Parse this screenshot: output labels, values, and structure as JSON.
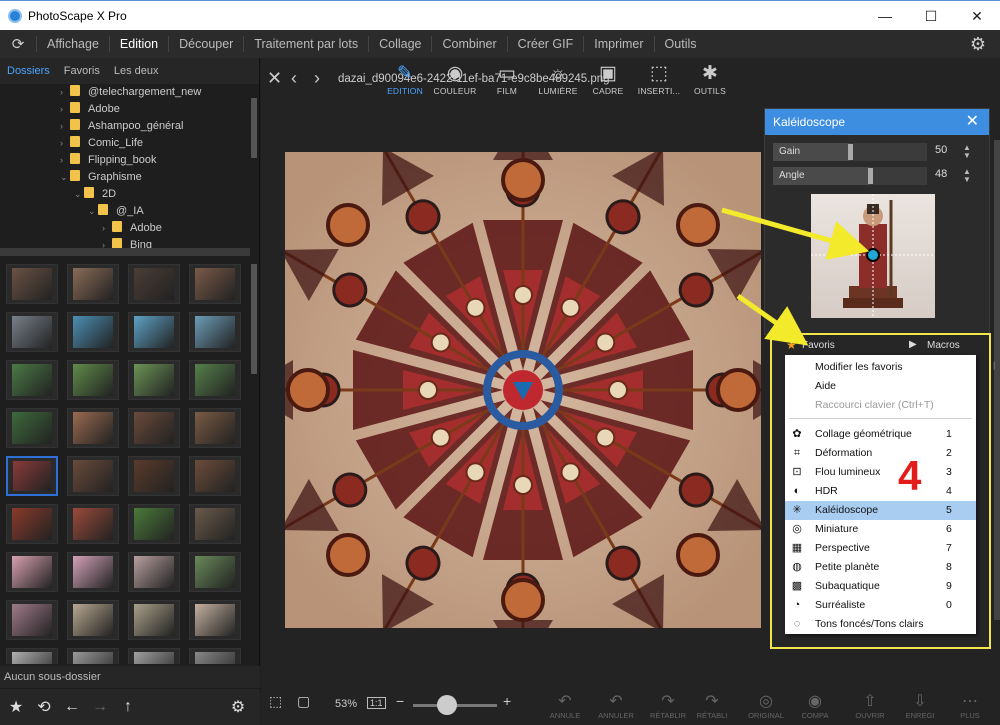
{
  "window": {
    "title": "PhotoScape X Pro",
    "controls": {
      "minimize": "—",
      "maximize": "☐",
      "close": "✕"
    }
  },
  "menu": {
    "items": [
      "Affichage",
      "Edition",
      "Découper",
      "Traitement par lots",
      "Collage",
      "Combiner",
      "Créer GIF",
      "Imprimer",
      "Outils"
    ],
    "active": "Edition"
  },
  "left_panel": {
    "tabs": [
      "Dossiers",
      "Favoris",
      "Les deux"
    ],
    "active_tab": "Dossiers",
    "tree": [
      {
        "label": "@telechargement_new",
        "indent": 0,
        "chev": "›"
      },
      {
        "label": "Adobe",
        "indent": 0,
        "chev": "›"
      },
      {
        "label": "Ashampoo_général",
        "indent": 0,
        "chev": "›"
      },
      {
        "label": "Comic_Life",
        "indent": 0,
        "chev": "›"
      },
      {
        "label": "Flipping_book",
        "indent": 0,
        "chev": "›"
      },
      {
        "label": "Graphisme",
        "indent": 0,
        "chev": "⌄"
      },
      {
        "label": "2D",
        "indent": 1,
        "chev": "⌄"
      },
      {
        "label": "@_IA",
        "indent": 2,
        "chev": "⌄"
      },
      {
        "label": "Adobe",
        "indent": 3,
        "chev": "›"
      },
      {
        "label": "Bing",
        "indent": 3,
        "chev": "›"
      }
    ],
    "no_subfolder": "Aucun sous-dossier"
  },
  "file": {
    "name": "dazai_d90094e6-2422-11ef-ba71-e9c8be489245.png"
  },
  "top_tools": [
    {
      "label": "EDITION",
      "icon": "edit-icon",
      "glyph": "✎",
      "active": true
    },
    {
      "label": "COULEUR",
      "icon": "color-icon",
      "glyph": "◉",
      "active": false
    },
    {
      "label": "FILM",
      "icon": "film-icon",
      "glyph": "▭",
      "active": false
    },
    {
      "label": "LUMIÈRE",
      "icon": "light-icon",
      "glyph": "☼",
      "active": false
    },
    {
      "label": "CADRE",
      "icon": "frame-icon",
      "glyph": "▣",
      "active": false
    },
    {
      "label": "INSERTI...",
      "icon": "insert-icon",
      "glyph": "⬚",
      "active": false
    },
    {
      "label": "OUTILS",
      "icon": "tools-icon",
      "glyph": "✱",
      "active": false
    }
  ],
  "bottom": {
    "zoom": "53%",
    "ratio": "1:1",
    "minus": "−",
    "plus": "+",
    "zoom_fraction": 0.4,
    "actions": [
      "ANNULE",
      "ANNULER",
      "RÉTABLIR",
      "RÉTABLI",
      "ORIGINAL",
      "COMPA",
      "OUVRIR",
      "ENREGI",
      "PLUS"
    ]
  },
  "kaleidoscope": {
    "title": "Kaléidoscope",
    "close": "✕",
    "params": [
      {
        "name": "Gain",
        "value": "50",
        "fraction": 0.5
      },
      {
        "name": "Angle",
        "value": "48",
        "fraction": 0.63
      }
    ]
  },
  "favorites": {
    "tab_favoris": "Favoris",
    "tab_macros": "Macros",
    "menu_top": [
      {
        "label": "Modifier les favoris",
        "disabled": false
      },
      {
        "label": "Aide",
        "disabled": false
      },
      {
        "label": "Raccourci clavier (Ctrl+T)",
        "disabled": true
      }
    ],
    "items": [
      {
        "label": "Collage géométrique",
        "num": "1",
        "icon": "geometric-collage-icon",
        "glyph": "✿"
      },
      {
        "label": "Déformation",
        "num": "2",
        "icon": "deformation-icon",
        "glyph": "⌗"
      },
      {
        "label": "Flou lumineux",
        "num": "3",
        "icon": "glow-blur-icon",
        "glyph": "⊡"
      },
      {
        "label": "HDR",
        "num": "4",
        "icon": "hdr-icon",
        "glyph": "◐"
      },
      {
        "label": "Kaléidoscope",
        "num": "5",
        "icon": "kaleidoscope-icon",
        "glyph": "✳",
        "highlight": true
      },
      {
        "label": "Miniature",
        "num": "6",
        "icon": "miniature-icon",
        "glyph": "◎"
      },
      {
        "label": "Perspective",
        "num": "7",
        "icon": "perspective-icon",
        "glyph": "▦"
      },
      {
        "label": "Petite planète",
        "num": "8",
        "icon": "little-planet-icon",
        "glyph": "◍"
      },
      {
        "label": "Subaquatique",
        "num": "9",
        "icon": "underwater-icon",
        "glyph": "▩"
      },
      {
        "label": "Surréaliste",
        "num": "0",
        "icon": "surreal-icon",
        "glyph": "◔"
      },
      {
        "label": "Tons foncés/Tons clairs",
        "num": "",
        "icon": "shadows-highlights-icon",
        "glyph": "◌"
      }
    ]
  },
  "annotation": {
    "number": "4",
    "color": "#e31b1b",
    "arrow_color": "#f2ea2a"
  },
  "colors": {
    "accent": "#3d8ee0",
    "highlight": "#a9cdf0",
    "folder": "#f2c34b"
  }
}
